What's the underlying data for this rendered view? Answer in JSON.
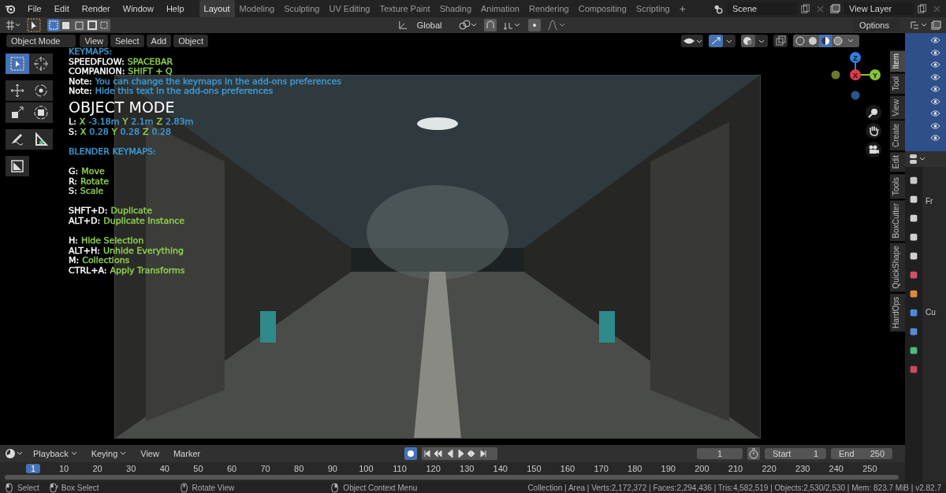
{
  "topbar": {
    "menus": [
      "File",
      "Edit",
      "Render",
      "Window",
      "Help"
    ],
    "workspaces": [
      {
        "label": "Layout",
        "selected": true
      },
      {
        "label": "Modeling",
        "selected": false
      },
      {
        "label": "Sculpting",
        "selected": false
      },
      {
        "label": "UV Editing",
        "selected": false
      },
      {
        "label": "Texture Paint",
        "selected": false
      },
      {
        "label": "Shading",
        "selected": false
      },
      {
        "label": "Animation",
        "selected": false
      },
      {
        "label": "Rendering",
        "selected": false
      },
      {
        "label": "Compositing",
        "selected": false
      },
      {
        "label": "Scripting",
        "selected": false
      }
    ],
    "add_tab": "+",
    "scene": "Scene",
    "view_layer": "View Layer"
  },
  "tool_header": {
    "orientation": "Global",
    "options": "Options"
  },
  "viewport": {
    "mode": "Object Mode",
    "menus": [
      "View",
      "Select",
      "Add",
      "Object"
    ],
    "tools": [
      {
        "kind": "select",
        "selected": true
      },
      {
        "kind": "cursor",
        "selected": false
      },
      {
        "kind": "move",
        "selected": false
      },
      {
        "kind": "rotate",
        "selected": false
      },
      {
        "kind": "scale",
        "selected": false
      },
      {
        "kind": "transform",
        "selected": false
      },
      {
        "kind": "annotate",
        "selected": false
      },
      {
        "kind": "measure",
        "selected": false
      },
      {
        "kind": "add",
        "selected": false
      }
    ],
    "overlay": [
      {
        "kind": "lines",
        "lines": [
          [
            {
              "text": "KEYMAPS:",
              "color": "#3e9bd6"
            }
          ],
          [
            {
              "text": "SPEEDFLOW:",
              "color": "#ffffff"
            },
            {
              "text": "SPACEBAR",
              "color": "#8fd14f"
            }
          ],
          [
            {
              "text": "COMPANION:",
              "color": "#ffffff"
            },
            {
              "text": "SHIFT + Q",
              "color": "#8fd14f"
            }
          ],
          [
            {
              "text": "Note:",
              "color": "#ffffff"
            },
            {
              "text": "You can change the keymaps in the add-ons preferences",
              "color": "#3e9bd6"
            }
          ],
          [
            {
              "text": "Note:",
              "color": "#ffffff"
            },
            {
              "text": "Hide this text in the add-ons preferences",
              "color": "#3e9bd6"
            }
          ]
        ]
      },
      {
        "kind": "title",
        "text": "OBJECT MODE"
      },
      {
        "kind": "lines",
        "lines": [
          [
            {
              "text": "L:",
              "color": "#ffffff"
            },
            {
              "text": "X",
              "color": "#8fd14f"
            },
            {
              "text": "-3.18m",
              "color": "#3e9bd6"
            },
            {
              "text": "Y",
              "color": "#8fd14f"
            },
            {
              "text": "2.1m",
              "color": "#3e9bd6"
            },
            {
              "text": "Z",
              "color": "#8fd14f"
            },
            {
              "text": "2.83m",
              "color": "#3e9bd6"
            }
          ],
          [
            {
              "text": "S:",
              "color": "#ffffff"
            },
            {
              "text": "X",
              "color": "#8fd14f"
            },
            {
              "text": "0.28",
              "color": "#3e9bd6"
            },
            {
              "text": "Y",
              "color": "#8fd14f"
            },
            {
              "text": "0.28",
              "color": "#3e9bd6"
            },
            {
              "text": "Z",
              "color": "#8fd14f"
            },
            {
              "text": "0.28",
              "color": "#3e9bd6"
            }
          ]
        ]
      },
      {
        "kind": "lines",
        "lines": [
          [
            {
              "text": "BLENDER KEYMAPS:",
              "color": "#3e9bd6"
            }
          ]
        ]
      },
      {
        "kind": "lines",
        "lines": [
          [
            {
              "text": "G:",
              "color": "#ffffff"
            },
            {
              "text": "Move",
              "color": "#8fd14f"
            }
          ],
          [
            {
              "text": "R:",
              "color": "#ffffff"
            },
            {
              "text": "Rotate",
              "color": "#8fd14f"
            }
          ],
          [
            {
              "text": "S:",
              "color": "#ffffff"
            },
            {
              "text": "Scale",
              "color": "#8fd14f"
            }
          ]
        ]
      },
      {
        "kind": "lines",
        "lines": [
          [
            {
              "text": "SHFT+D:",
              "color": "#ffffff"
            },
            {
              "text": "Duplicate",
              "color": "#8fd14f"
            }
          ],
          [
            {
              "text": "ALT+D:",
              "color": "#ffffff"
            },
            {
              "text": "Duplicate Instance",
              "color": "#8fd14f"
            }
          ]
        ]
      },
      {
        "kind": "lines",
        "lines": [
          [
            {
              "text": "H:",
              "color": "#ffffff"
            },
            {
              "text": "Hide Selection",
              "color": "#8fd14f"
            }
          ],
          [
            {
              "text": "ALT+H:",
              "color": "#ffffff"
            },
            {
              "text": "Unhide Everything",
              "color": "#8fd14f"
            }
          ],
          [
            {
              "text": "M:",
              "color": "#ffffff"
            },
            {
              "text": "Collections",
              "color": "#8fd14f"
            }
          ],
          [
            {
              "text": "CTRL+A:",
              "color": "#ffffff"
            },
            {
              "text": "Apply Transforms",
              "color": "#8fd14f"
            }
          ]
        ]
      }
    ],
    "gizmo": [
      {
        "label": "Z",
        "color": "#2f7fe0"
      },
      {
        "label": "X",
        "color": "#e03a4a"
      },
      {
        "label": "Y",
        "color": "#86c33a"
      }
    ],
    "sidebar_tabs": [
      {
        "label": "Item",
        "selected": true
      },
      {
        "label": "Tool",
        "selected": false
      },
      {
        "label": "View",
        "selected": false
      },
      {
        "label": "Create",
        "selected": false
      },
      {
        "label": "Edit",
        "selected": false
      },
      {
        "label": "Tools",
        "selected": false
      },
      {
        "label": "BoxCutter",
        "selected": false
      },
      {
        "label": "QuickShape",
        "selected": false
      },
      {
        "label": "HardOps",
        "selected": false
      }
    ]
  },
  "properties": {
    "labels": [
      "Fr",
      "Cu"
    ]
  },
  "timeline": {
    "menus": [
      {
        "label": "Playback",
        "dropdown": true
      },
      {
        "label": "Keying",
        "dropdown": true
      },
      {
        "label": "View",
        "dropdown": false
      },
      {
        "label": "Marker",
        "dropdown": false
      }
    ],
    "current_frame": "1",
    "start_label": "Start",
    "start": "1",
    "end_label": "End",
    "end": "250",
    "ruler": [
      {
        "label": "1",
        "selected": true
      },
      {
        "label": "10",
        "selected": false
      },
      {
        "label": "20",
        "selected": false
      },
      {
        "label": "30",
        "selected": false
      },
      {
        "label": "40",
        "selected": false
      },
      {
        "label": "50",
        "selected": false
      },
      {
        "label": "60",
        "selected": false
      },
      {
        "label": "70",
        "selected": false
      },
      {
        "label": "80",
        "selected": false
      },
      {
        "label": "90",
        "selected": false
      },
      {
        "label": "100",
        "selected": false
      },
      {
        "label": "110",
        "selected": false
      },
      {
        "label": "120",
        "selected": false
      },
      {
        "label": "130",
        "selected": false
      },
      {
        "label": "140",
        "selected": false
      },
      {
        "label": "150",
        "selected": false
      },
      {
        "label": "160",
        "selected": false
      },
      {
        "label": "170",
        "selected": false
      },
      {
        "label": "180",
        "selected": false
      },
      {
        "label": "190",
        "selected": false
      },
      {
        "label": "200",
        "selected": false
      },
      {
        "label": "210",
        "selected": false
      },
      {
        "label": "220",
        "selected": false
      },
      {
        "label": "230",
        "selected": false
      },
      {
        "label": "240",
        "selected": false
      },
      {
        "label": "250",
        "selected": false
      }
    ]
  },
  "status_bar": {
    "hints": [
      {
        "label": "Select",
        "kind": "left"
      },
      {
        "label": "Box Select",
        "kind": "drag"
      },
      {
        "label": "Rotate View",
        "kind": "middle"
      },
      {
        "label": "Object Context Menu",
        "kind": "right"
      }
    ],
    "stats": "Collection | Area | Verts:2,172,372 | Faces:2,294,436 | Tris:4,582,519 | Objects:2,530/2,530 | Mem: 823.7 MiB | v2.82.7"
  }
}
